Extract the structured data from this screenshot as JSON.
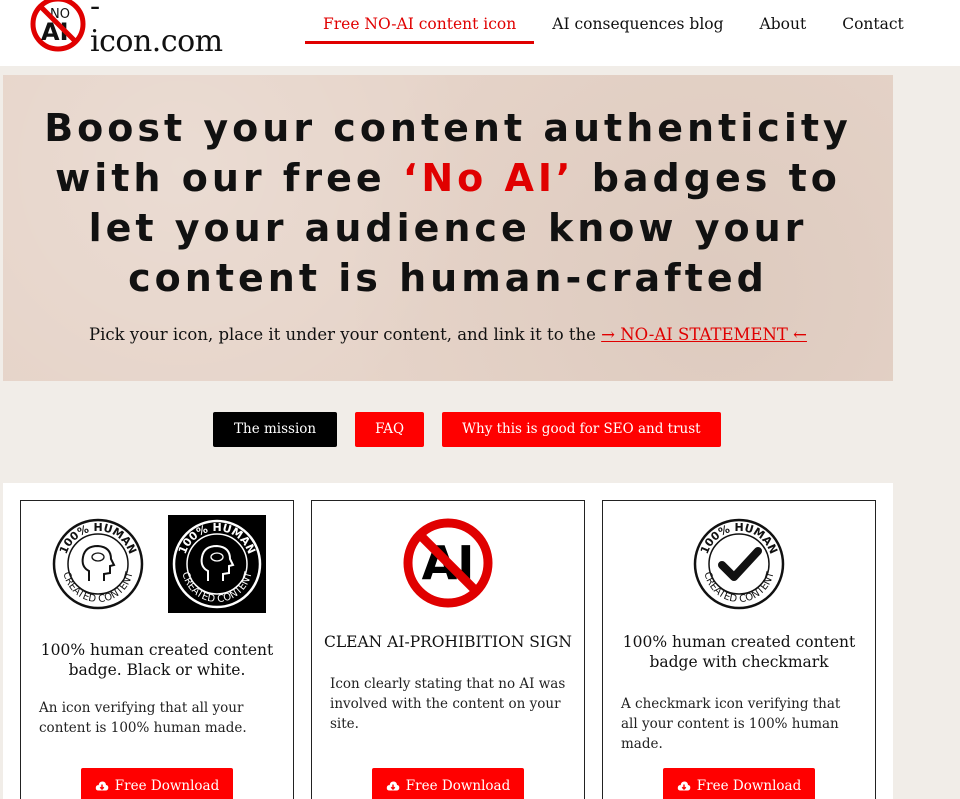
{
  "header": {
    "logo_badge_top": "NO",
    "logo_badge_main": "AI",
    "logo_suffix": "-icon.com",
    "nav": [
      {
        "label": "Free NO-AI content icon",
        "active": true
      },
      {
        "label": "AI consequences blog",
        "active": false
      },
      {
        "label": "About",
        "active": false
      },
      {
        "label": "Contact",
        "active": false
      }
    ]
  },
  "hero": {
    "title_part1": "Boost your content authenticity with our free ",
    "title_highlight": "‘No AI’",
    "title_part2": " badges to let your audience know your content is human-crafted",
    "subtitle_text": "Pick your icon, place it under your content, and link it to the ",
    "subtitle_link": "→ NO-AI STATEMENT ←"
  },
  "buttons": {
    "mission": "The mission",
    "faq": "FAQ",
    "seo": "Why this is good for SEO and trust"
  },
  "cards": [
    {
      "title": "100% human created content badge. Black or white.",
      "description": "An icon verifying that all your content is 100% human made.",
      "download_label": "Free Download",
      "badge_top": "100% HUMAN",
      "badge_bottom": "CREATED CONTENT"
    },
    {
      "title": "CLEAN AI-PROHIBITION SIGN",
      "description": "Icon clearly stating that no AI was involved with the content on your site.",
      "download_label": "Free Download",
      "sign_text": "AI"
    },
    {
      "title": "100% human created content badge with checkmark",
      "description": "A checkmark icon verifying that all your content is 100% human made.",
      "download_label": "Free Download",
      "badge_top": "100% HUMAN",
      "badge_bottom": "CREATED CONTENT"
    }
  ],
  "colors": {
    "accent": "#ff0000",
    "hero_bg": "#e6d4c9",
    "page_bg": "#f1ede8"
  },
  "icons": {
    "download": "cloud-download-icon",
    "logo": "no-ai-prohibition-icon"
  }
}
